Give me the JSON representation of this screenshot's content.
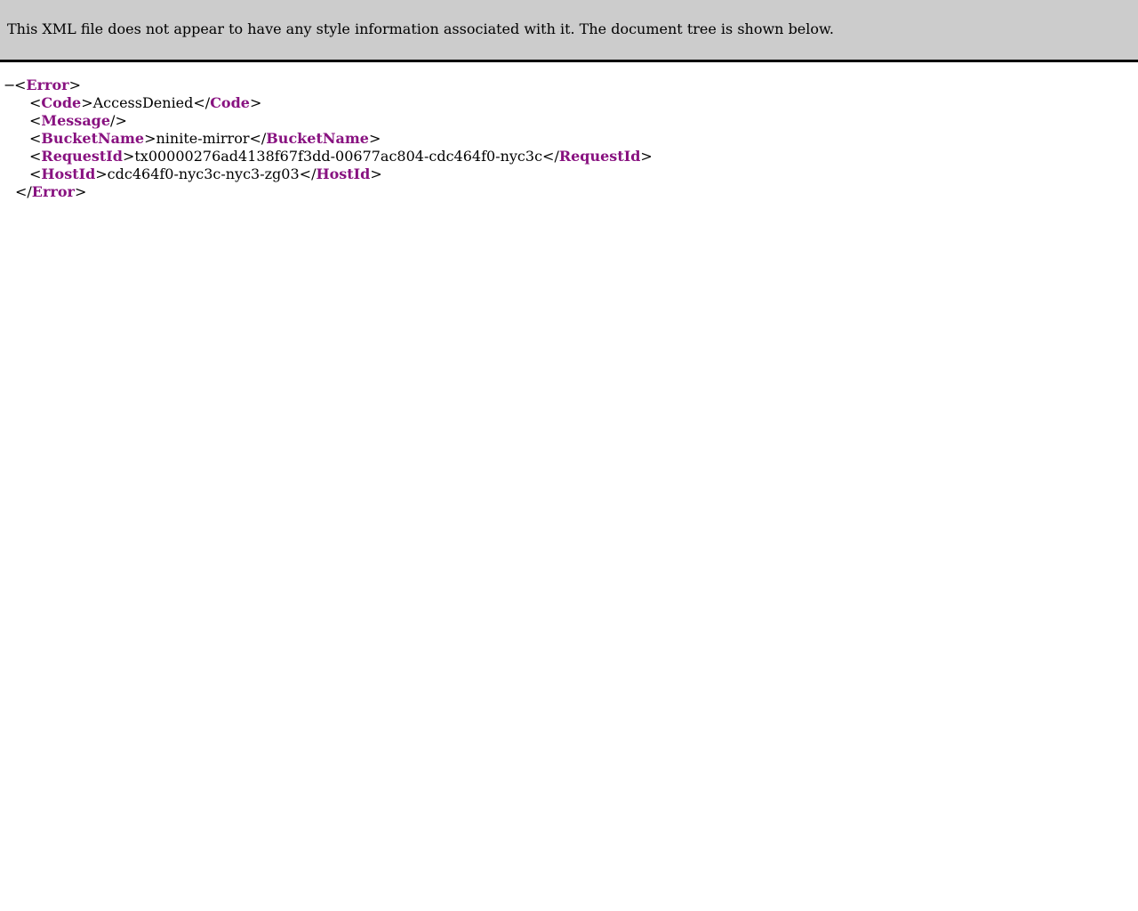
{
  "info_bar": {
    "text": "This XML file does not appear to have any style information associated with it. The document tree is shown below."
  },
  "tree": {
    "collapse_symbol": "−",
    "root": "Error",
    "children": [
      {
        "tag": "Code",
        "value": "AccessDenied"
      },
      {
        "tag": "Message",
        "self_closing": true
      },
      {
        "tag": "BucketName",
        "value": "ninite-mirror"
      },
      {
        "tag": "RequestId",
        "value": "tx00000276ad4138f67f3dd-00677ac804-cdc464f0-nyc3c"
      },
      {
        "tag": "HostId",
        "value": "cdc464f0-nyc3c-nyc3-zg03"
      }
    ]
  },
  "colors": {
    "tag": "#881280",
    "header_bg": "#cccccc"
  }
}
